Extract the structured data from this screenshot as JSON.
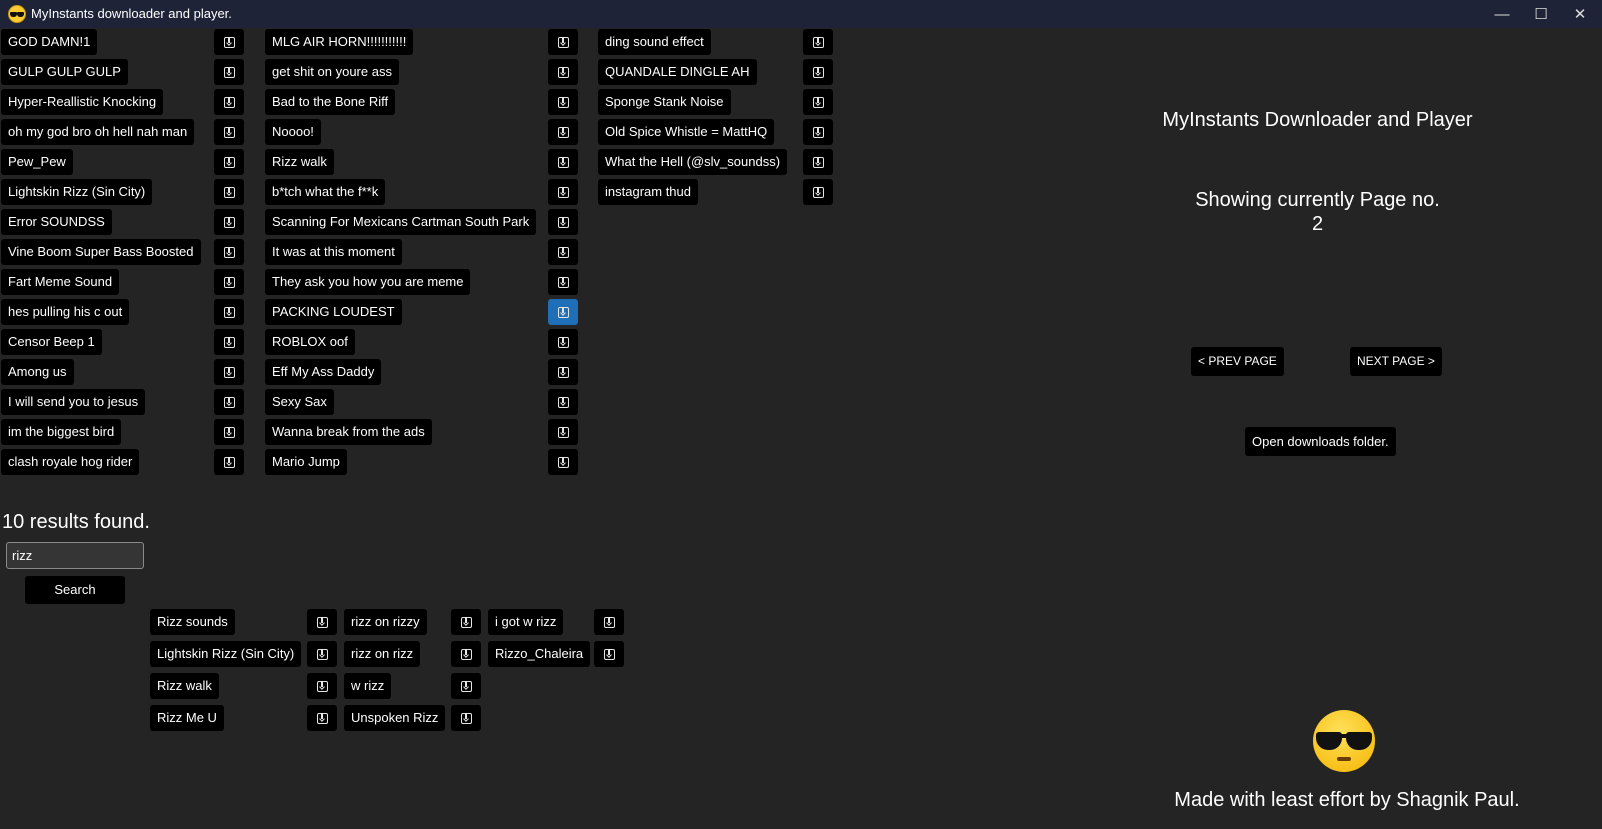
{
  "window": {
    "title": "MyInstants downloader and player.",
    "icon": "sunglasses-emoji-icon",
    "minimize_glyph": "—",
    "maximize_glyph": "☐",
    "close_glyph": "✕"
  },
  "sound_list": {
    "col1": [
      "GOD DAMN!1",
      "GULP GULP GULP",
      "Hyper-Reallistic Knocking",
      "oh my god bro oh hell nah man",
      "Pew_Pew",
      "Lightskin Rizz (Sin City)",
      "Error SOUNDSS",
      "Vine Boom Super Bass Boosted",
      "Fart Meme Sound",
      "hes pulling his c out",
      "Censor Beep 1",
      "Among us",
      "I will send you to jesus",
      "im the biggest bird",
      "clash royale hog rider"
    ],
    "col2": [
      "MLG AIR HORN!!!!!!!!!!!",
      "get shit on youre ass",
      "Bad to the Bone Riff",
      "Noooo!",
      "Rizz walk",
      "b*tch what the f**k",
      "Scanning For Mexicans Cartman South Park",
      "It was at this moment",
      "They ask you how you are meme",
      "PACKING LOUDEST",
      "ROBLOX oof",
      "Eff My Ass Daddy",
      "Sexy Sax",
      "Wanna break from the ads",
      "Mario Jump"
    ],
    "col3": [
      "ding sound effect",
      "QUANDALE DINGLE AH",
      "Sponge Stank Noise",
      "Old Spice Whistle = MattHQ",
      "What the Hell (@slv_soundss)",
      "instagram thud"
    ]
  },
  "search": {
    "results_text": "10 results found.",
    "query": "rizz",
    "button_label": "Search"
  },
  "search_results": {
    "col1": [
      "Rizz sounds",
      "Lightskin Rizz (Sin City)",
      "Rizz walk",
      "Rizz Me U"
    ],
    "col2": [
      "rizz on rizzy",
      "rizz on rizz",
      "w rizz",
      "Unspoken Rizz"
    ],
    "col3": [
      "i got w rizz",
      "Rizzo_Chaleira"
    ]
  },
  "sidebar": {
    "title": "MyInstants Downloader and Player",
    "page_label": "Showing currently Page no.",
    "page_number": "2",
    "prev_label": "< PREV PAGE",
    "next_label": "NEXT PAGE >",
    "open_folder_label": "Open downloads folder.",
    "emoji_icon": "sunglasses-emoji-icon",
    "credits": "Made with least effort by Shagnik Paul."
  },
  "icons": {
    "download": "download-icon"
  },
  "colors": {
    "background": "#242424",
    "titlebar": "#1e2338",
    "button": "#000000",
    "active_download": "#1f6fb8"
  }
}
